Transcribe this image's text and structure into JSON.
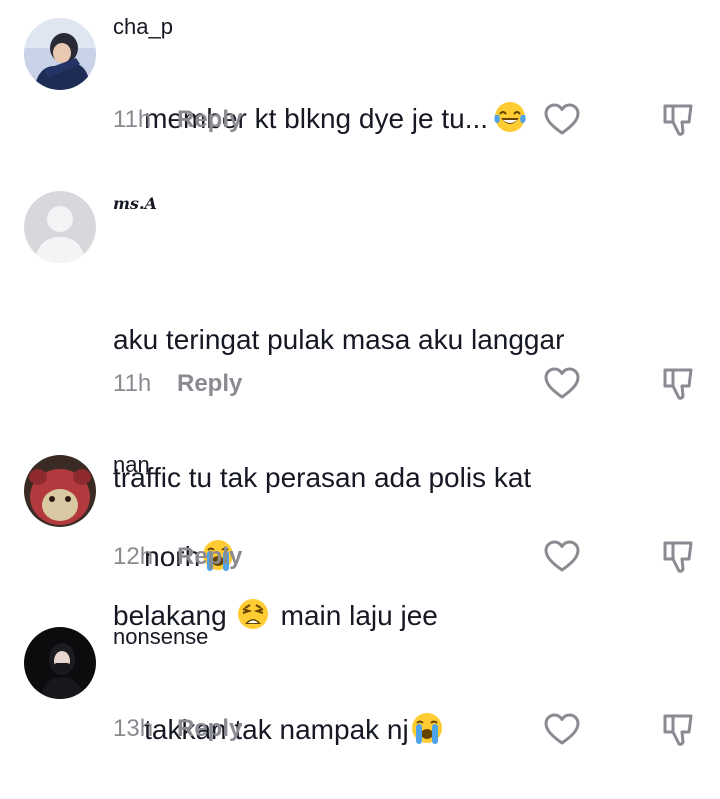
{
  "comments": [
    {
      "username": "cha_p",
      "text": "member kt blkng dye je tu...",
      "emoji": "tears-of-joy-emoji",
      "time": "11h",
      "reply": "Reply"
    },
    {
      "username": "ms.A",
      "line1": "aku teringat pulak masa aku langgar",
      "line2": "traffic tu tak perasan ada polis kat",
      "line3a": "belakang",
      "line3b": "main laju jee",
      "emoji": "weary-face-emoji",
      "time": "11h",
      "reply": "Reply"
    },
    {
      "username": "nan",
      "text": "norh",
      "emoji": "loudly-crying-face-emoji",
      "time": "12h",
      "reply": "Reply"
    },
    {
      "username": "nonsense",
      "text": "takkan tak nampak nj",
      "emoji": "loudly-crying-face-emoji",
      "time": "13h",
      "reply": "Reply"
    }
  ],
  "icons": {
    "like": "heart-outline-icon",
    "dislike": "thumbs-down-outline-icon"
  },
  "colors": {
    "text": "#161823",
    "meta": "#8a8b91",
    "emoji_yellow": "#ffcc33"
  }
}
